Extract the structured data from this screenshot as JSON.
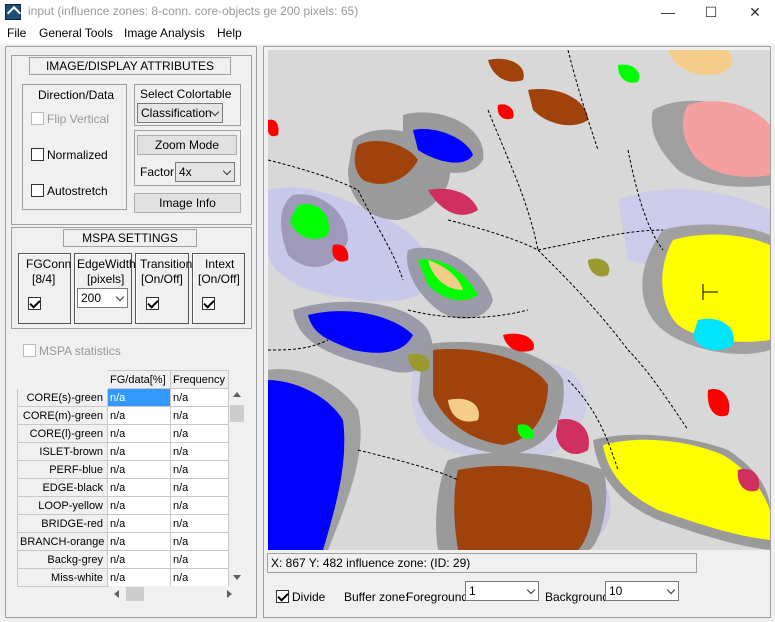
{
  "window": {
    "title": "input (influence zones: 8-conn. core-objects ge 200 pixels: 65)",
    "minimize": "—",
    "maximize": "☐",
    "close": "✕"
  },
  "menu": [
    "File",
    "General Tools",
    "Image Analysis",
    "Help"
  ],
  "image_display": {
    "title": "IMAGE/DISPLAY ATTRIBUTES",
    "direction_label": "Direction/Data",
    "flip_vertical": "Flip Vertical",
    "normalized": "Normalized",
    "autostretch": "Autostretch",
    "select_colortable_label": "Select Colortable",
    "colortable_value": "Classification",
    "zoom_mode_button": "Zoom Mode",
    "factor_label": "Factor:",
    "factor_value": "4x",
    "image_info_button": "Image Info"
  },
  "mspa": {
    "title": "MSPA SETTINGS",
    "fgconn_label": "FGConn",
    "fgconn_sub": "[8/4]",
    "edgewidth_label": "EdgeWidth",
    "edgewidth_sub": "[pixels]",
    "edgewidth_value": "200",
    "transition_label": "Transition",
    "transition_sub": "[On/Off]",
    "intext_label": "Intext",
    "intext_sub": "[On/Off]",
    "statistics": "MSPA statistics"
  },
  "table": {
    "columns": [
      "FG/data[%]",
      "Frequency"
    ],
    "rows": [
      {
        "label": "CORE(s)-green",
        "fg": "n/a",
        "freq": "n/a"
      },
      {
        "label": "CORE(m)-green",
        "fg": "n/a",
        "freq": "n/a"
      },
      {
        "label": "CORE(l)-green",
        "fg": "n/a",
        "freq": "n/a"
      },
      {
        "label": "ISLET-brown",
        "fg": "n/a",
        "freq": "n/a"
      },
      {
        "label": "PERF-blue",
        "fg": "n/a",
        "freq": "n/a"
      },
      {
        "label": "EDGE-black",
        "fg": "n/a",
        "freq": "n/a"
      },
      {
        "label": "LOOP-yellow",
        "fg": "n/a",
        "freq": "n/a"
      },
      {
        "label": "BRIDGE-red",
        "fg": "n/a",
        "freq": "n/a"
      },
      {
        "label": "BRANCH-orange",
        "fg": "n/a",
        "freq": "n/a"
      },
      {
        "label": "Backg-grey",
        "fg": "n/a",
        "freq": "n/a"
      },
      {
        "label": "Miss-white",
        "fg": "n/a",
        "freq": "n/a"
      }
    ]
  },
  "status": {
    "text": "X: 867   Y: 482   influence zone: (ID: 29)"
  },
  "bottom": {
    "divide_label": "Divide",
    "buffer_zone_label": "Buffer zone:",
    "foreground_label": "Foreground:",
    "foreground_value": "1",
    "background_label": "Background",
    "background_value": "10"
  },
  "colors": {
    "map_background": "#d8d8d8",
    "core_green": "#00ff00",
    "islet_brown": "#a0420c",
    "perf_blue": "#0000ff",
    "loop_yellow": "#ffff00",
    "bridge_red": "#ff0000",
    "salmon": "#f4a0a0",
    "tan": "#f5cd8a",
    "buffer_purple": "#b08ad0",
    "cyan": "#00e5ff",
    "magenta": "#d03060",
    "olive": "#9a9a30"
  }
}
